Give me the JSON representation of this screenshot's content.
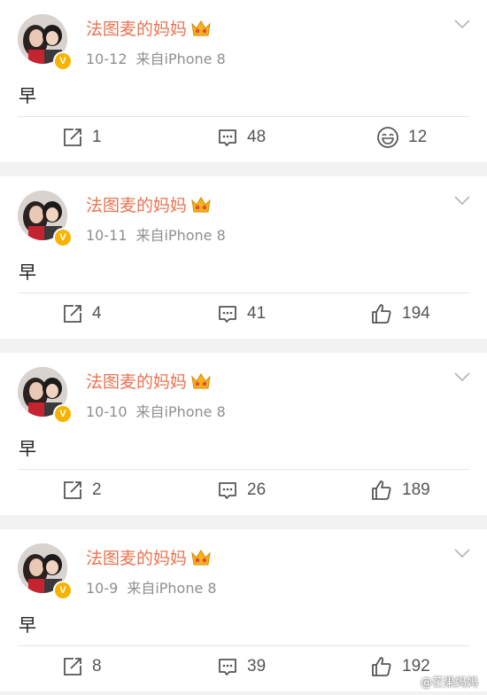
{
  "colors": {
    "username": "#eb7350",
    "meta": "#8f8f8f",
    "badge": "#f6b400",
    "icon": "#555555"
  },
  "posts": [
    {
      "username": "法图麦的妈妈",
      "date": "10-12",
      "source": "来自iPhone 8",
      "content": "早",
      "repost_count": "1",
      "comment_count": "48",
      "reaction_count": "12",
      "reaction_icon": "laugh-emoji-icon"
    },
    {
      "username": "法图麦的妈妈",
      "date": "10-11",
      "source": "来自iPhone 8",
      "content": "早",
      "repost_count": "4",
      "comment_count": "41",
      "reaction_count": "194",
      "reaction_icon": "thumbs-up-icon"
    },
    {
      "username": "法图麦的妈妈",
      "date": "10-10",
      "source": "来自iPhone 8",
      "content": "早",
      "repost_count": "2",
      "comment_count": "26",
      "reaction_count": "189",
      "reaction_icon": "thumbs-up-icon"
    },
    {
      "username": "法图麦的妈妈",
      "date": "10-9",
      "source": "来自iPhone 8",
      "content": "早",
      "repost_count": "8",
      "comment_count": "39",
      "reaction_count": "192",
      "reaction_icon": "thumbs-up-icon"
    }
  ],
  "watermark": {
    "text": "@芒果妈妈"
  }
}
